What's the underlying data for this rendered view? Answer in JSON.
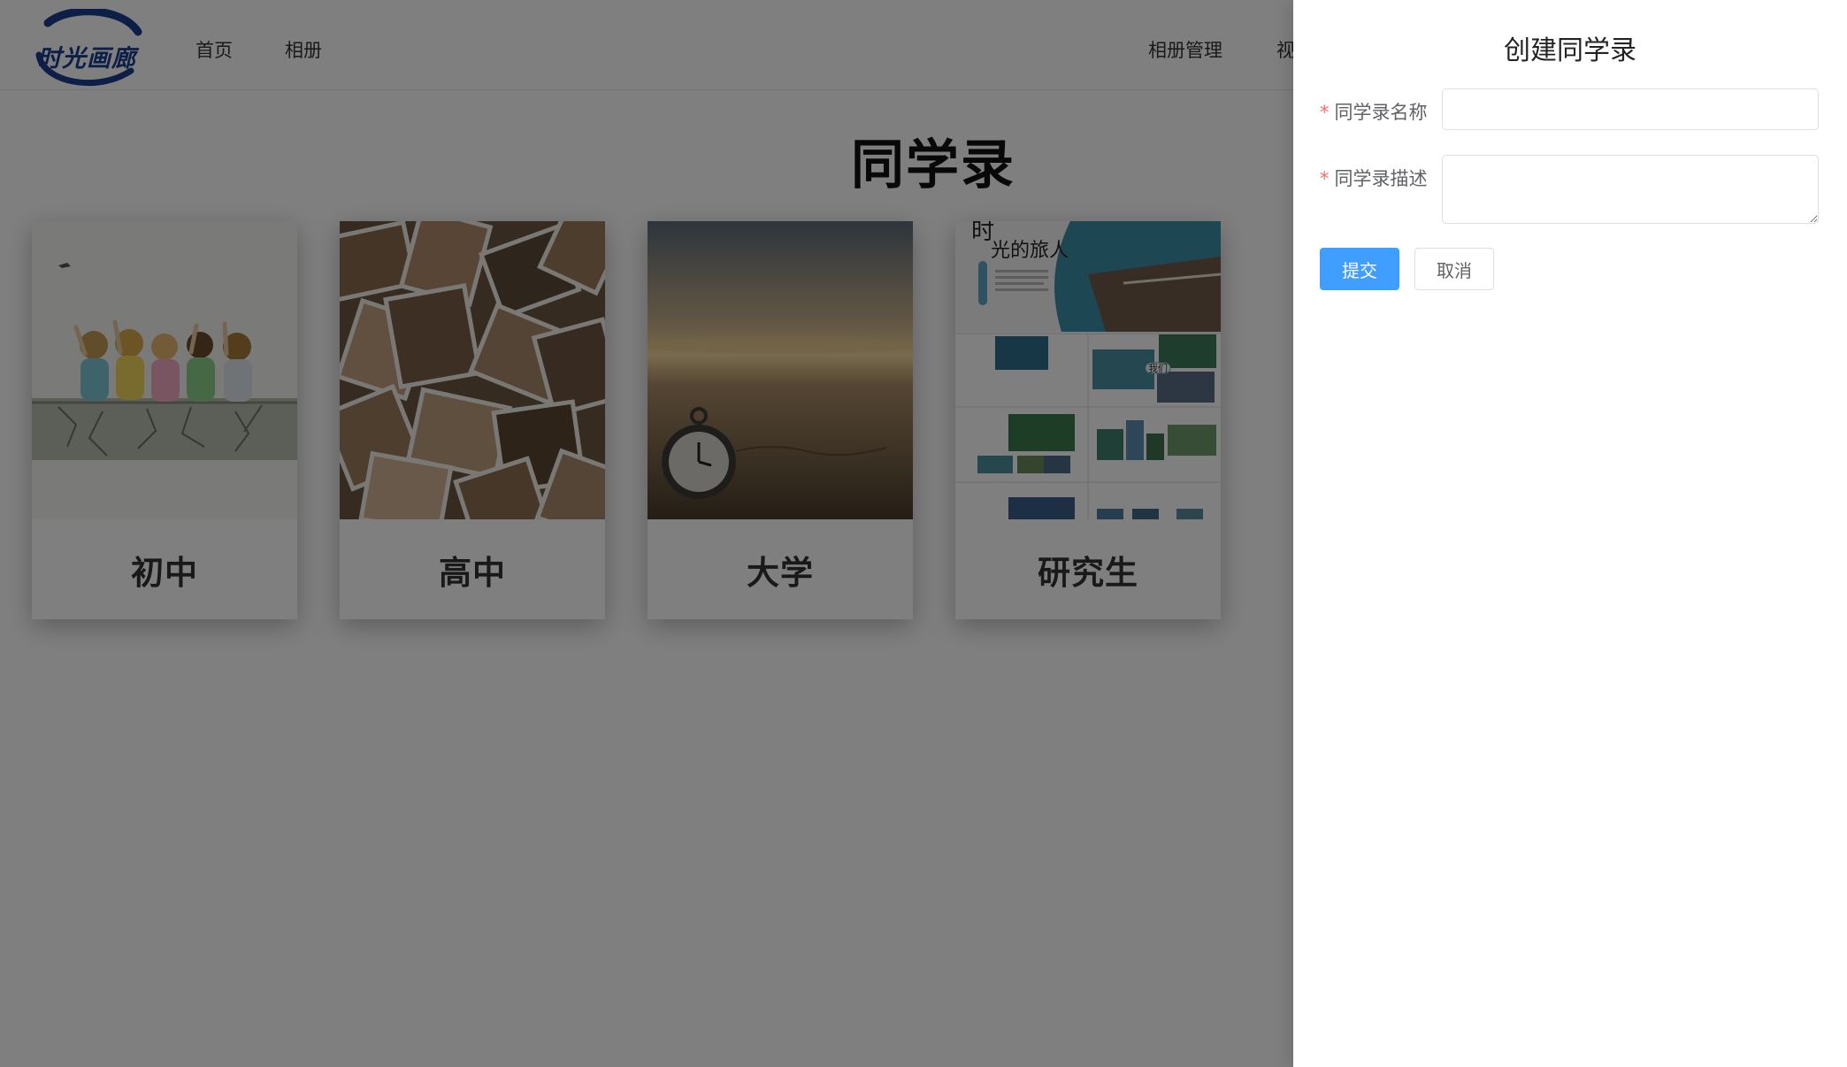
{
  "header": {
    "logo_text": "时光画廊",
    "nav": [
      {
        "label": "首页"
      },
      {
        "label": "相册"
      }
    ],
    "right_nav": [
      {
        "label": "相册管理"
      },
      {
        "label": "视"
      }
    ]
  },
  "main": {
    "title": "同学录",
    "cards": [
      {
        "label": "初中",
        "image": "children-sitting-on-wall-illustration"
      },
      {
        "label": "高中",
        "image": "photo-collage"
      },
      {
        "label": "大学",
        "image": "pocket-watch-on-beach"
      },
      {
        "label": "研究生",
        "image": "travel-brochure-collage"
      }
    ],
    "card4_image_text": {
      "headline_1": "时",
      "headline_2": "光的旅人",
      "badge": "我们"
    }
  },
  "drawer": {
    "title": "创建同学录",
    "fields": [
      {
        "required_mark": "*",
        "label": "同学录名称",
        "value": "",
        "placeholder": ""
      },
      {
        "required_mark": "*",
        "label": "同学录描述",
        "value": "",
        "placeholder": ""
      }
    ],
    "submit_label": "提交",
    "cancel_label": "取消"
  },
  "colors": {
    "primary": "#409eff",
    "required": "#f56c6c",
    "logo_blue": "#1b3f8f",
    "overlay": "rgba(0,0,0,0.5)"
  }
}
